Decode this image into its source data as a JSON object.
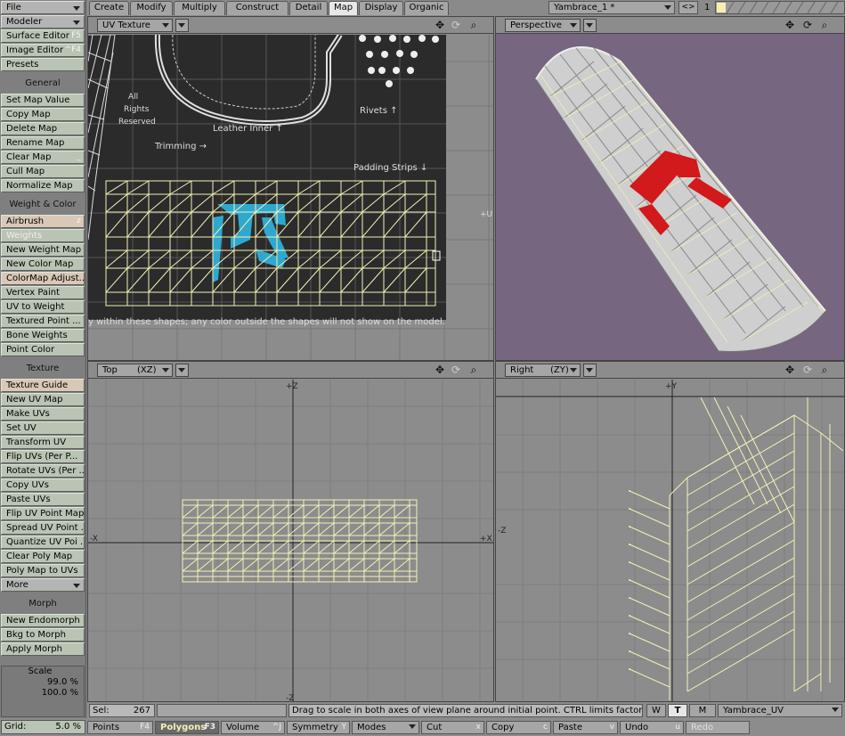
{
  "sidebar": {
    "file": "File",
    "modeler": "Modeler",
    "top_items": [
      {
        "label": "Surface Editor",
        "shortcut": "F5"
      },
      {
        "label": "Image Editor",
        "shortcut": "^F4"
      },
      {
        "label": "Presets",
        "shortcut": ""
      }
    ],
    "general_header": "General",
    "general_items": [
      {
        "label": "Set Map Value",
        "shortcut": ""
      },
      {
        "label": "Copy Map",
        "shortcut": ""
      },
      {
        "label": "Delete Map",
        "shortcut": ""
      },
      {
        "label": "Rename Map",
        "shortcut": ""
      },
      {
        "label": "Clear Map",
        "shortcut": "_"
      },
      {
        "label": "Cull Map",
        "shortcut": ""
      },
      {
        "label": "Normalize Map",
        "shortcut": ""
      }
    ],
    "weight_header": "Weight & Color",
    "weight_items": [
      {
        "label": "Airbrush",
        "shortcut": "z"
      },
      {
        "label": "Weights",
        "shortcut": ""
      },
      {
        "label": "New Weight Map",
        "shortcut": ""
      },
      {
        "label": "New Color Map",
        "shortcut": ""
      },
      {
        "label": "ColorMap Adjust...",
        "shortcut": ""
      },
      {
        "label": "Vertex Paint",
        "shortcut": ""
      },
      {
        "label": "UV to Weight",
        "shortcut": ""
      },
      {
        "label": "Textured Point ...",
        "shortcut": ""
      },
      {
        "label": "Bone Weights",
        "shortcut": ""
      },
      {
        "label": "Point Color",
        "shortcut": ""
      }
    ],
    "texture_header": "Texture",
    "texture_items": [
      {
        "label": "Texture Guide",
        "shortcut": ""
      },
      {
        "label": "New UV Map",
        "shortcut": ""
      },
      {
        "label": "Make UVs",
        "shortcut": ""
      },
      {
        "label": "Set UV",
        "shortcut": ""
      },
      {
        "label": "Transform UV",
        "shortcut": ""
      },
      {
        "label": "Flip UVs (Per P...",
        "shortcut": ""
      },
      {
        "label": "Rotate UVs (Per ...",
        "shortcut": ""
      },
      {
        "label": "Copy UVs",
        "shortcut": ""
      },
      {
        "label": "Paste UVs",
        "shortcut": ""
      },
      {
        "label": "Flip UV Point Map",
        "shortcut": ""
      },
      {
        "label": "Spread UV Point ...",
        "shortcut": ""
      },
      {
        "label": "Quantize UV Poi ...",
        "shortcut": ""
      },
      {
        "label": "Clear Poly Map",
        "shortcut": ""
      },
      {
        "label": "Poly Map to UVs",
        "shortcut": ""
      }
    ],
    "more": "More",
    "morph_header": "Morph",
    "morph_items": [
      {
        "label": "New Endomorph",
        "shortcut": ""
      },
      {
        "label": "Bkg to Morph",
        "shortcut": ""
      },
      {
        "label": "Apply Morph",
        "shortcut": ""
      }
    ],
    "scale_label": "Scale",
    "scale_values": [
      "99.0 %",
      "100.0 %"
    ],
    "grid_label": "Grid:",
    "grid_value": "5.0 %"
  },
  "tabs": [
    "Create",
    "Modify",
    "Multiply",
    "Construct",
    "Detail",
    "Map",
    "Display",
    "Organic"
  ],
  "active_tab": "Map",
  "object_name": "Yambrace_1 *",
  "layer_number": "1",
  "viewports": {
    "uv": {
      "mode": "UV Texture",
      "axis_label": "+U"
    },
    "perspective": {
      "mode": "Perspective"
    },
    "top": {
      "mode": "Top",
      "axes": "(XZ)",
      "label_top": "+Z",
      "label_bottom": "-Z",
      "label_left": "-X",
      "label_right": "+X"
    },
    "right": {
      "mode": "Right",
      "axes": "(ZY)",
      "label_top": "+Y",
      "label_left": "-Z"
    }
  },
  "uv_texture_text": {
    "all_rights": "All Rights Reserved",
    "leather_inner": "Leather Inner ↑",
    "trimming": "Trimming →",
    "rivets": "Rivets ↑",
    "padding": "Padding Strips ↓",
    "footer": "y within these shapes; any color outside the shapes will not show on the model."
  },
  "status": {
    "sel_label": "Sel:",
    "sel_value": "267",
    "message": "Drag to scale in both axes of view plane around initial point. CTRL limits factors.",
    "w": "W",
    "t": "T",
    "m": "M",
    "map_name": "Yambrace_UV"
  },
  "bottom_bar": [
    {
      "label": "Points",
      "shortcut": "F4"
    },
    {
      "label": "Polygons",
      "shortcut": "F3"
    },
    {
      "label": "Volume",
      "shortcut": "^J"
    },
    {
      "label": "Symmetry",
      "shortcut": "Y"
    },
    {
      "label": "Modes",
      "shortcut": ""
    },
    {
      "label": "Cut",
      "shortcut": "x"
    },
    {
      "label": "Copy",
      "shortcut": "c"
    },
    {
      "label": "Paste",
      "shortcut": "v"
    },
    {
      "label": "Undo",
      "shortcut": "u"
    },
    {
      "label": "Redo",
      "shortcut": ""
    }
  ],
  "colors": {
    "wire": "#f3f1b6",
    "grid_bg": "#8c8c8c",
    "persp_bg": "#77667f",
    "uv_bg": "#2d2d2d",
    "cyan": "#2fa8d0",
    "red": "#d2191b"
  }
}
